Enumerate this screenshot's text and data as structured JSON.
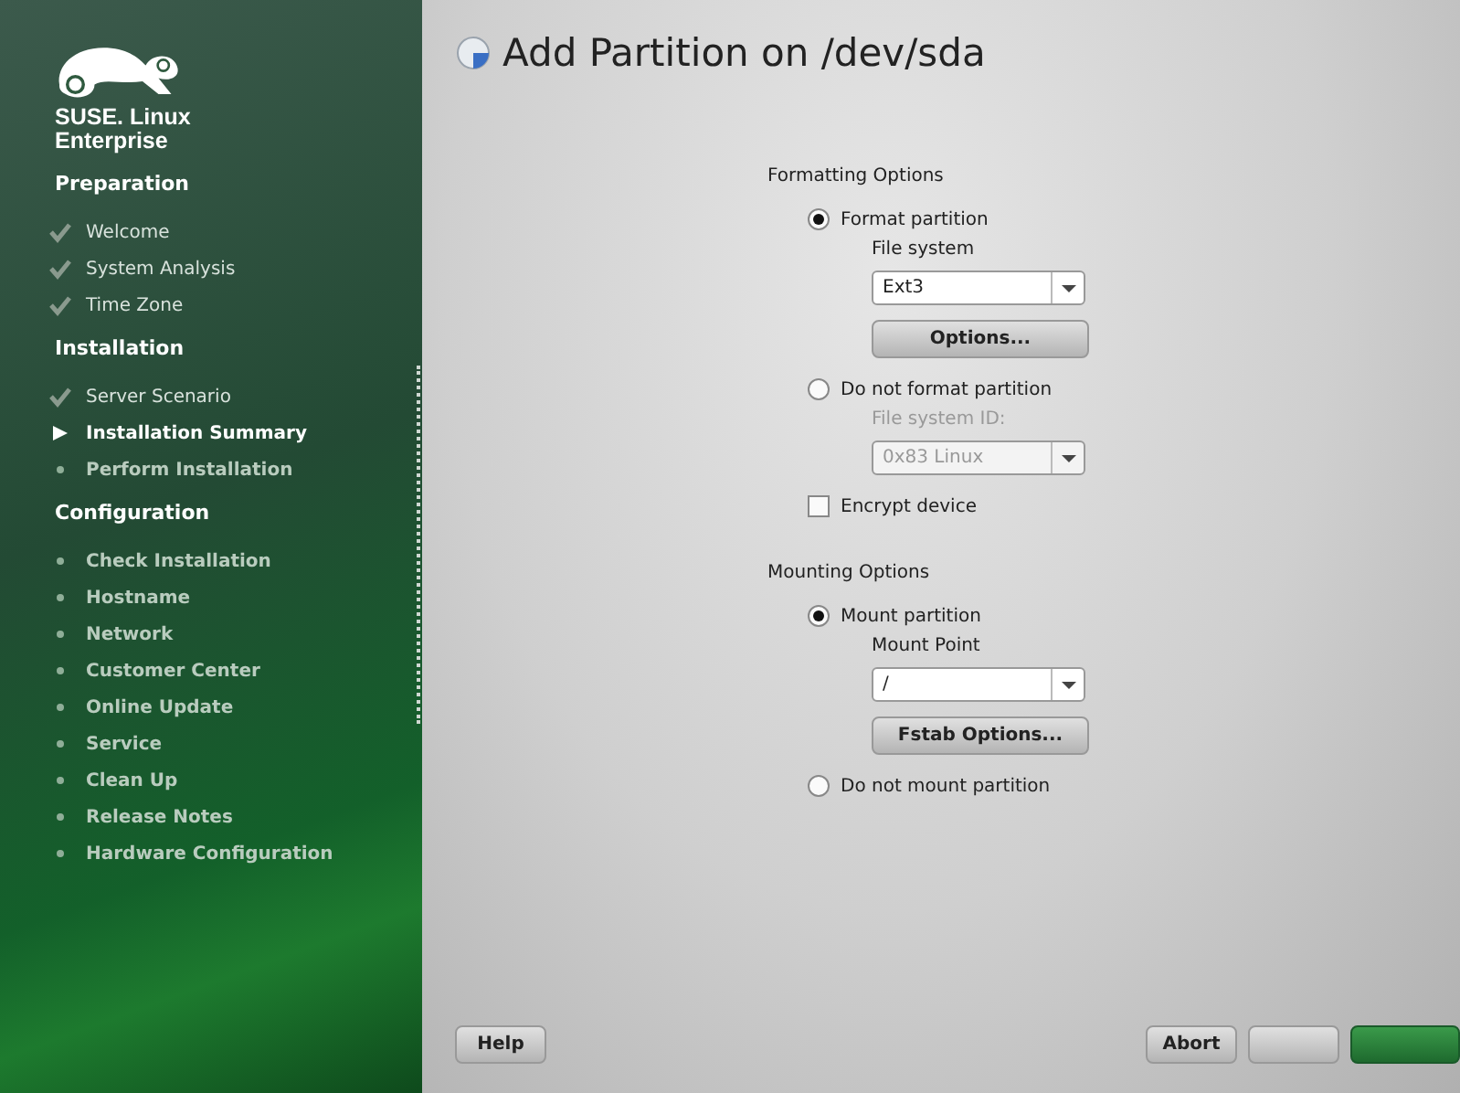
{
  "sidebar": {
    "logo_text": [
      "SUSE. Linux",
      "Enterprise"
    ],
    "sections": [
      {
        "title": "Preparation",
        "items": [
          {
            "label": "Welcome",
            "kind": "done"
          },
          {
            "label": "System Analysis",
            "kind": "done"
          },
          {
            "label": "Time Zone",
            "kind": "done"
          }
        ]
      },
      {
        "title": "Installation",
        "items": [
          {
            "label": "Server Scenario",
            "kind": "done"
          },
          {
            "label": "Installation Summary",
            "kind": "current"
          },
          {
            "label": "Perform Installation",
            "kind": "pending"
          }
        ]
      },
      {
        "title": "Configuration",
        "items": [
          {
            "label": "Check Installation",
            "kind": "pending"
          },
          {
            "label": "Hostname",
            "kind": "pending"
          },
          {
            "label": "Network",
            "kind": "pending"
          },
          {
            "label": "Customer Center",
            "kind": "pending"
          },
          {
            "label": "Online Update",
            "kind": "pending"
          },
          {
            "label": "Service",
            "kind": "pending"
          },
          {
            "label": "Clean Up",
            "kind": "pending"
          },
          {
            "label": "Release Notes",
            "kind": "pending"
          },
          {
            "label": "Hardware Configuration",
            "kind": "pending"
          }
        ]
      }
    ]
  },
  "title": "Add Partition on /dev/sda",
  "formatting": {
    "heading": "Formatting Options",
    "format": {
      "label": "Format partition",
      "selected": true
    },
    "file_system": {
      "label": "File system",
      "value": "Ext3",
      "disabled": false
    },
    "options_button": "Options...",
    "no_format": {
      "label": "Do not format partition",
      "selected": false
    },
    "file_system_id": {
      "label": "File system ID:",
      "value": "0x83 Linux",
      "disabled": true
    },
    "encrypt": {
      "label": "Encrypt device",
      "checked": false
    }
  },
  "mounting": {
    "heading": "Mounting Options",
    "mount": {
      "label": "Mount partition",
      "selected": true
    },
    "mount_point": {
      "label": "Mount Point",
      "value": "/",
      "disabled": false
    },
    "fstab_button": "Fstab Options...",
    "no_mount": {
      "label": "Do not mount partition",
      "selected": false
    }
  },
  "buttons": {
    "help": "Help",
    "abort": "Abort"
  }
}
